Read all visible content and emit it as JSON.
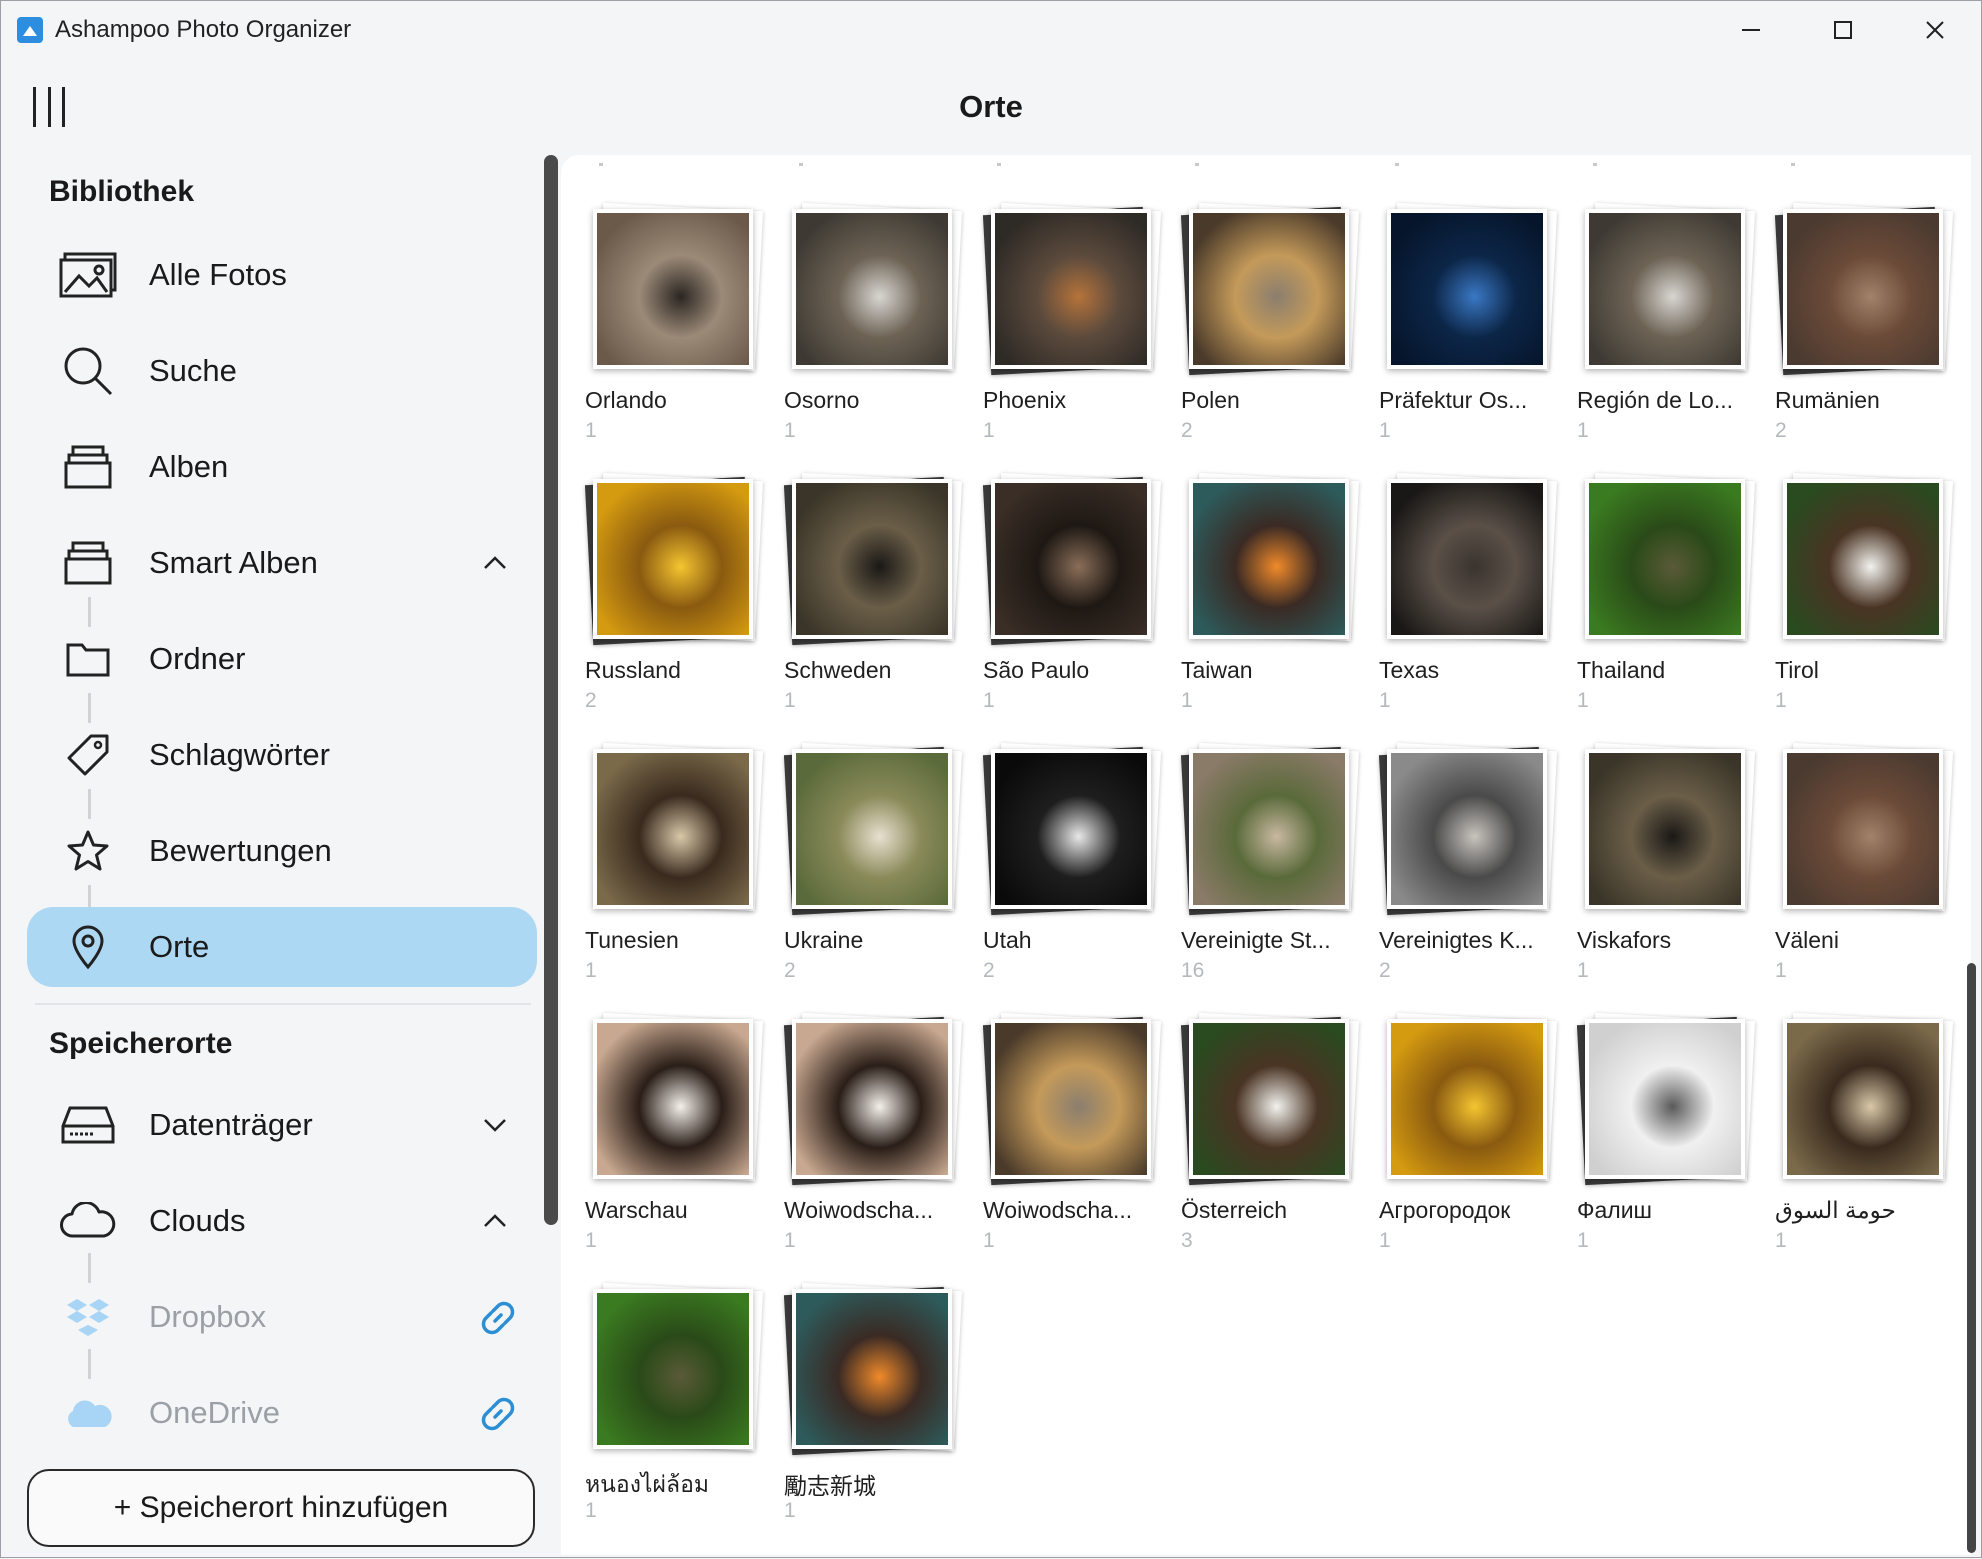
{
  "window": {
    "title": "Ashampoo Photo Organizer"
  },
  "header": {
    "title": "Orte"
  },
  "sidebar": {
    "library_title": "Bibliothek",
    "items": [
      {
        "label": "Alle Fotos",
        "icon": "photos-icon"
      },
      {
        "label": "Suche",
        "icon": "search-icon"
      },
      {
        "label": "Alben",
        "icon": "albums-icon"
      },
      {
        "label": "Smart Alben",
        "icon": "smart-albums-icon"
      },
      {
        "label": "Ordner",
        "icon": "folder-icon"
      },
      {
        "label": "Schlagwörter",
        "icon": "tag-icon"
      },
      {
        "label": "Bewertungen",
        "icon": "star-icon"
      },
      {
        "label": "Orte",
        "icon": "location-pin-icon"
      }
    ],
    "storage_title": "Speicherorte",
    "storage_items": [
      {
        "label": "Datenträger",
        "icon": "drive-icon"
      },
      {
        "label": "Clouds",
        "icon": "cloud-icon"
      },
      {
        "label": "Dropbox",
        "icon": "dropbox-icon"
      },
      {
        "label": "OneDrive",
        "icon": "onedrive-icon"
      }
    ],
    "add_button": "+ Speicherort hinzufügen"
  },
  "places": [
    {
      "name": "Orlando",
      "count": "1",
      "colors": [
        "#6b5a4a",
        "#2b2622",
        "#9c8a78"
      ],
      "stacked": false
    },
    {
      "name": "Osorno",
      "count": "1",
      "colors": [
        "#3e3a33",
        "#d8d6d2",
        "#6d6355"
      ],
      "stacked": false
    },
    {
      "name": "Phoenix",
      "count": "1",
      "colors": [
        "#2e2a26",
        "#b5733b",
        "#5b4a3c"
      ],
      "stacked": true
    },
    {
      "name": "Polen",
      "count": "2",
      "colors": [
        "#4a3a2a",
        "#8b7e6e",
        "#c49a5a"
      ],
      "stacked": true
    },
    {
      "name": "Präfektur Os...",
      "count": "1",
      "colors": [
        "#06152b",
        "#3a78c4",
        "#0c2648"
      ],
      "stacked": false
    },
    {
      "name": "Región de Lo...",
      "count": "1",
      "colors": [
        "#3e3a33",
        "#d8d6d2",
        "#6d6355"
      ],
      "stacked": false
    },
    {
      "name": "Rumänien",
      "count": "2",
      "colors": [
        "#4a3a30",
        "#a3826a",
        "#6b4a38"
      ],
      "stacked": true
    },
    {
      "name": "Russland",
      "count": "2",
      "colors": [
        "#d49a10",
        "#f4c530",
        "#8a5a10"
      ],
      "stacked": true
    },
    {
      "name": "Schweden",
      "count": "1",
      "colors": [
        "#3a3528",
        "#1a1816",
        "#6a5e48"
      ],
      "stacked": true
    },
    {
      "name": "São Paulo",
      "count": "1",
      "colors": [
        "#3a2e26",
        "#8a6e58",
        "#1e1814"
      ],
      "stacked": true
    },
    {
      "name": "Taiwan",
      "count": "1",
      "colors": [
        "#2d5a5a",
        "#f08a2a",
        "#3a2a24"
      ],
      "stacked": false
    },
    {
      "name": "Texas",
      "count": "1",
      "colors": [
        "#1a1816",
        "#3a342e",
        "#5a5048"
      ],
      "stacked": false
    },
    {
      "name": "Thailand",
      "count": "1",
      "colors": [
        "#3a7a20",
        "#5a5a38",
        "#2a4a18"
      ],
      "stacked": false
    },
    {
      "name": "Tirol",
      "count": "1",
      "colors": [
        "#2a4a20",
        "#f2f2ee",
        "#4a3424"
      ],
      "stacked": false
    },
    {
      "name": "Tunesien",
      "count": "1",
      "colors": [
        "#7a6a4a",
        "#d8c8a8",
        "#3a2a1e"
      ],
      "stacked": false
    },
    {
      "name": "Ukraine",
      "count": "2",
      "colors": [
        "#5a6a3a",
        "#e8e0d0",
        "#8a8a5a"
      ],
      "stacked": true
    },
    {
      "name": "Utah",
      "count": "2",
      "colors": [
        "#0a0a0a",
        "#e8e8e8",
        "#1e1e1e"
      ],
      "stacked": true
    },
    {
      "name": "Vereinigte St...",
      "count": "16",
      "colors": [
        "#8a7a68",
        "#c8b8a0",
        "#5a6a3a"
      ],
      "stacked": true
    },
    {
      "name": "Vereinigtes K...",
      "count": "2",
      "colors": [
        "#8a8a8a",
        "#c8c4be",
        "#4a4a4a"
      ],
      "stacked": true
    },
    {
      "name": "Viskafors",
      "count": "1",
      "colors": [
        "#3a3528",
        "#1a1816",
        "#6a5e48"
      ],
      "stacked": false
    },
    {
      "name": "Väleni",
      "count": "1",
      "colors": [
        "#4a3a30",
        "#a3826a",
        "#6b4a38"
      ],
      "stacked": false
    },
    {
      "name": "Warschau",
      "count": "1",
      "colors": [
        "#c8a890",
        "#f4f0ea",
        "#2a1e18"
      ],
      "stacked": false
    },
    {
      "name": "Woiwodscha...",
      "count": "1",
      "colors": [
        "#c8a890",
        "#f4f0ea",
        "#2a1e18"
      ],
      "stacked": true
    },
    {
      "name": "Woiwodscha...",
      "count": "1",
      "colors": [
        "#4a3a2a",
        "#8b7e6e",
        "#c49a5a"
      ],
      "stacked": true
    },
    {
      "name": "Österreich",
      "count": "3",
      "colors": [
        "#2a4a20",
        "#f2f2ee",
        "#4a3424"
      ],
      "stacked": true
    },
    {
      "name": "Агрогородок",
      "count": "1",
      "colors": [
        "#d49a10",
        "#f4c530",
        "#8a5a10"
      ],
      "stacked": false
    },
    {
      "name": "Фалиш",
      "count": "1",
      "colors": [
        "#d0d0d0",
        "#5a5a5a",
        "#f0f0f0"
      ],
      "stacked": true
    },
    {
      "name": "حومة السوق",
      "count": "1",
      "colors": [
        "#7a6a4a",
        "#d8c8a8",
        "#3a2a1e"
      ],
      "stacked": false
    },
    {
      "name": "หนองไผ่ล้อม",
      "count": "1",
      "colors": [
        "#3a7a20",
        "#5a5a38",
        "#2a4a18"
      ],
      "stacked": false
    },
    {
      "name": "勵志新城",
      "count": "1",
      "colors": [
        "#2d5a5a",
        "#f08a2a",
        "#3a2a24"
      ],
      "stacked": true
    }
  ]
}
